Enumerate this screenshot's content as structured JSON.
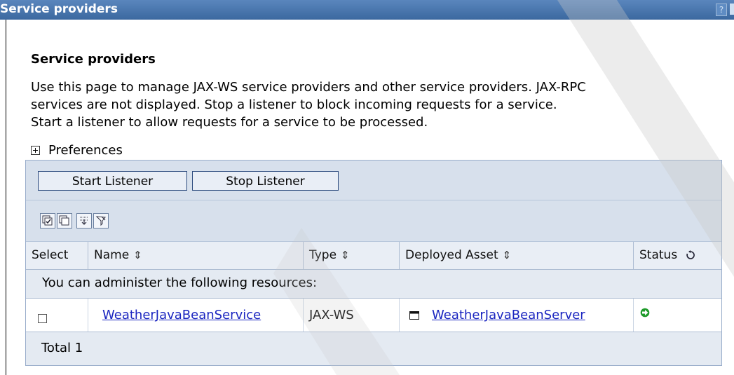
{
  "window": {
    "title": "Service providers",
    "help_label": "?"
  },
  "page": {
    "heading": "Service providers",
    "description_lines": [
      "Use this page to manage JAX-WS service providers and other service providers. JAX-RPC",
      "services are not displayed. Stop a listener to block incoming requests for a service.",
      "Start a listener to allow requests for a service to be processed."
    ],
    "preferences_label": "Preferences"
  },
  "toolbar": {
    "start_label": "Start Listener",
    "stop_label": "Stop Listener",
    "icons": [
      "select-all-icon",
      "deselect-all-icon",
      "show-filter-icon",
      "clear-filter-icon"
    ]
  },
  "table": {
    "columns": {
      "select": "Select",
      "name": "Name",
      "type": "Type",
      "asset": "Deployed Asset",
      "status": "Status"
    },
    "sort_glyph": "⇕",
    "info": "You can administer the following resources:",
    "rows": [
      {
        "selected": false,
        "name": "WeatherJavaBeanService",
        "type": "JAX-WS",
        "asset": "WeatherJavaBeanServer",
        "status_icon": "started-arrow-icon"
      }
    ],
    "total": "Total 1"
  },
  "colors": {
    "titlebar": "#3f6fa8",
    "panel_bg": "#d7e0ec",
    "link": "#1a25c0",
    "status_green": "#1e9a2a"
  }
}
